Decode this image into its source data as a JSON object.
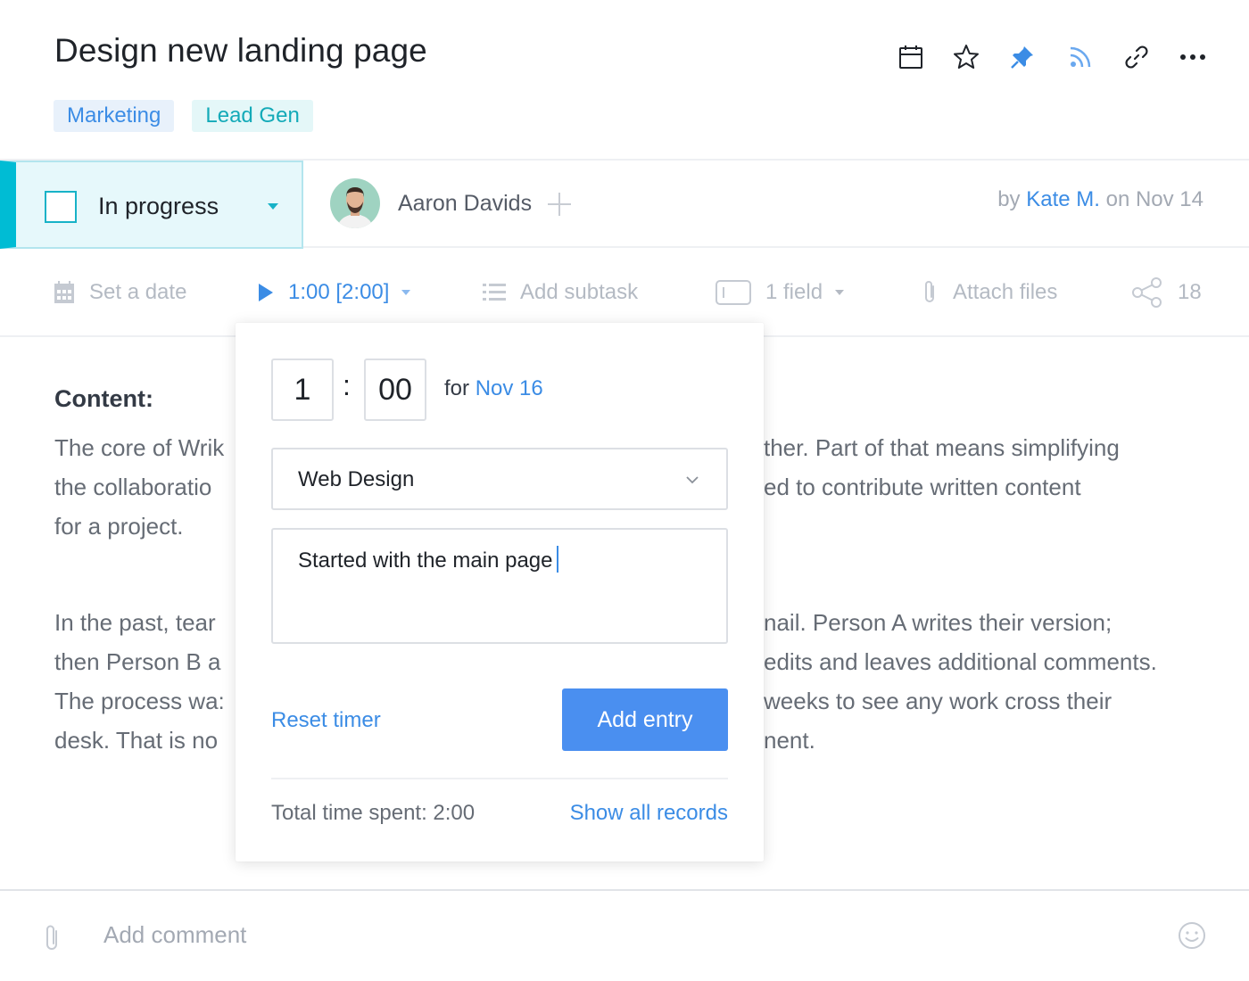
{
  "task": {
    "title": "Design new landing page",
    "tags": [
      {
        "label": "Marketing",
        "color": "#3b8ce5"
      },
      {
        "label": "Lead Gen",
        "color": "#13aab8"
      }
    ]
  },
  "toolbar": {
    "icons": [
      "calendar-icon",
      "star-icon",
      "pin-icon",
      "rss-icon",
      "link-icon",
      "more-icon"
    ],
    "pin_color": "#3b8ce5"
  },
  "status": {
    "label": "In progress",
    "accent": "#00bcd4"
  },
  "assignee": {
    "name": "Aaron Davids"
  },
  "author": {
    "prefix": "by",
    "name": "Kate M.",
    "suffix": "on Nov 14"
  },
  "actions": {
    "set_date": "Set a date",
    "timer": "1:00 [2:00]",
    "add_subtask": "Add subtask",
    "fields": "1 field",
    "attach": "Attach files",
    "shares": "18"
  },
  "content": {
    "heading": "Content:",
    "paragraph1": [
      "The core of Wrik",
      "the collaboratio",
      "for a project."
    ],
    "paragraph1_right": [
      "ther. Part of that means simplifying",
      "ed to contribute written content",
      ""
    ],
    "paragraph2": [
      "In the past, tear",
      "then Person B a",
      "The process wa:",
      "desk. That is no"
    ],
    "paragraph2_right": [
      "nail. Person A writes their version;",
      "edits and leaves additional comments.",
      "weeks to see any work cross their",
      "nent."
    ]
  },
  "timer_popup": {
    "hours": "1",
    "minutes": "00",
    "for_label": "for",
    "date": "Nov 16",
    "category": "Web Design",
    "note": "Started with the main page",
    "reset_label": "Reset timer",
    "add_label": "Add entry",
    "total_label": "Total time spent: 2:00",
    "show_all_label": "Show all records"
  },
  "comment": {
    "placeholder": "Add comment"
  }
}
